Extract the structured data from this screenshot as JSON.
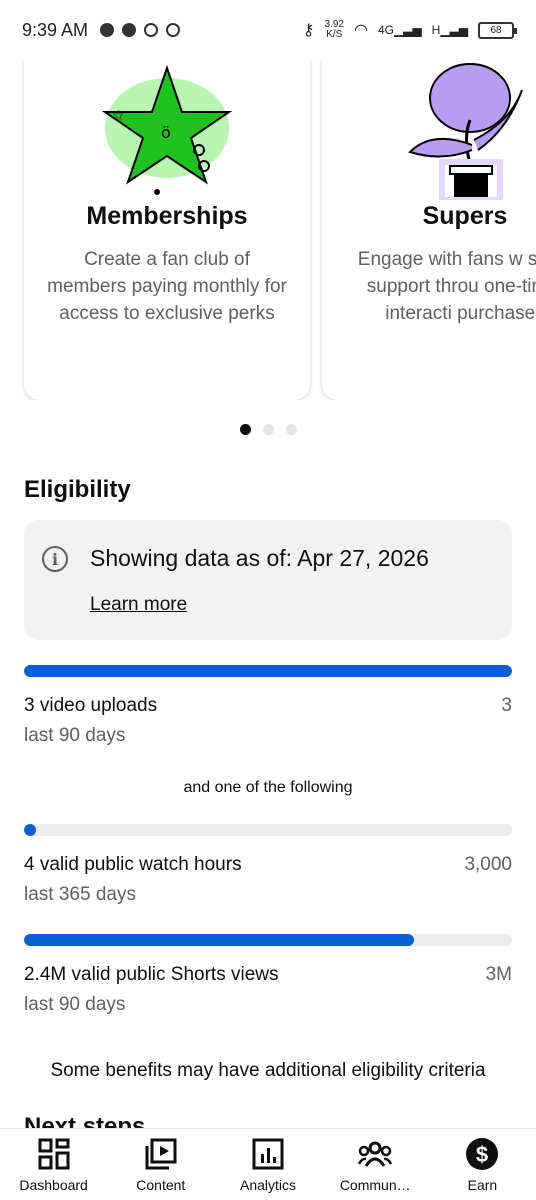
{
  "status_bar": {
    "time": "9:39 AM",
    "speed_value": "3.92",
    "speed_unit": "K/S",
    "network": "4G",
    "network2": "H",
    "battery": "68"
  },
  "cards": [
    {
      "title": "Memberships",
      "description": "Create a fan club of members paying monthly for access to exclusive perks"
    },
    {
      "title": "Supers",
      "description": "Engage with fans w show support throu one-time, interacti purchases"
    }
  ],
  "carousel": {
    "page_count": 3,
    "active_index": 0
  },
  "eligibility": {
    "heading": "Eligibility",
    "info_text": "Showing data as of: Apr 27, 2026",
    "learn_more": "Learn more",
    "following_text": "and one of the following",
    "requirements": [
      {
        "label": "3 video uploads",
        "period": "last 90 days",
        "target": "3",
        "progress": 1.0
      },
      {
        "label": "4 valid public watch hours",
        "period": "last 365 days",
        "target": "3,000",
        "progress": 0.0013
      },
      {
        "label": "2.4M valid public Shorts views",
        "period": "last 90 days",
        "target": "3M",
        "progress": 0.8
      }
    ],
    "note": "Some benefits may have additional eligibility criteria"
  },
  "next_steps_heading": "Next steps",
  "bottom_nav": [
    {
      "label": "Dashboard",
      "icon": "dashboard-icon"
    },
    {
      "label": "Content",
      "icon": "content-icon"
    },
    {
      "label": "Analytics",
      "icon": "analytics-icon"
    },
    {
      "label": "Commun…",
      "icon": "community-icon"
    },
    {
      "label": "Earn",
      "icon": "earn-icon"
    }
  ],
  "colors": {
    "accent": "#065fd4",
    "track": "#ececec",
    "info_bg": "#f2f2f2"
  }
}
